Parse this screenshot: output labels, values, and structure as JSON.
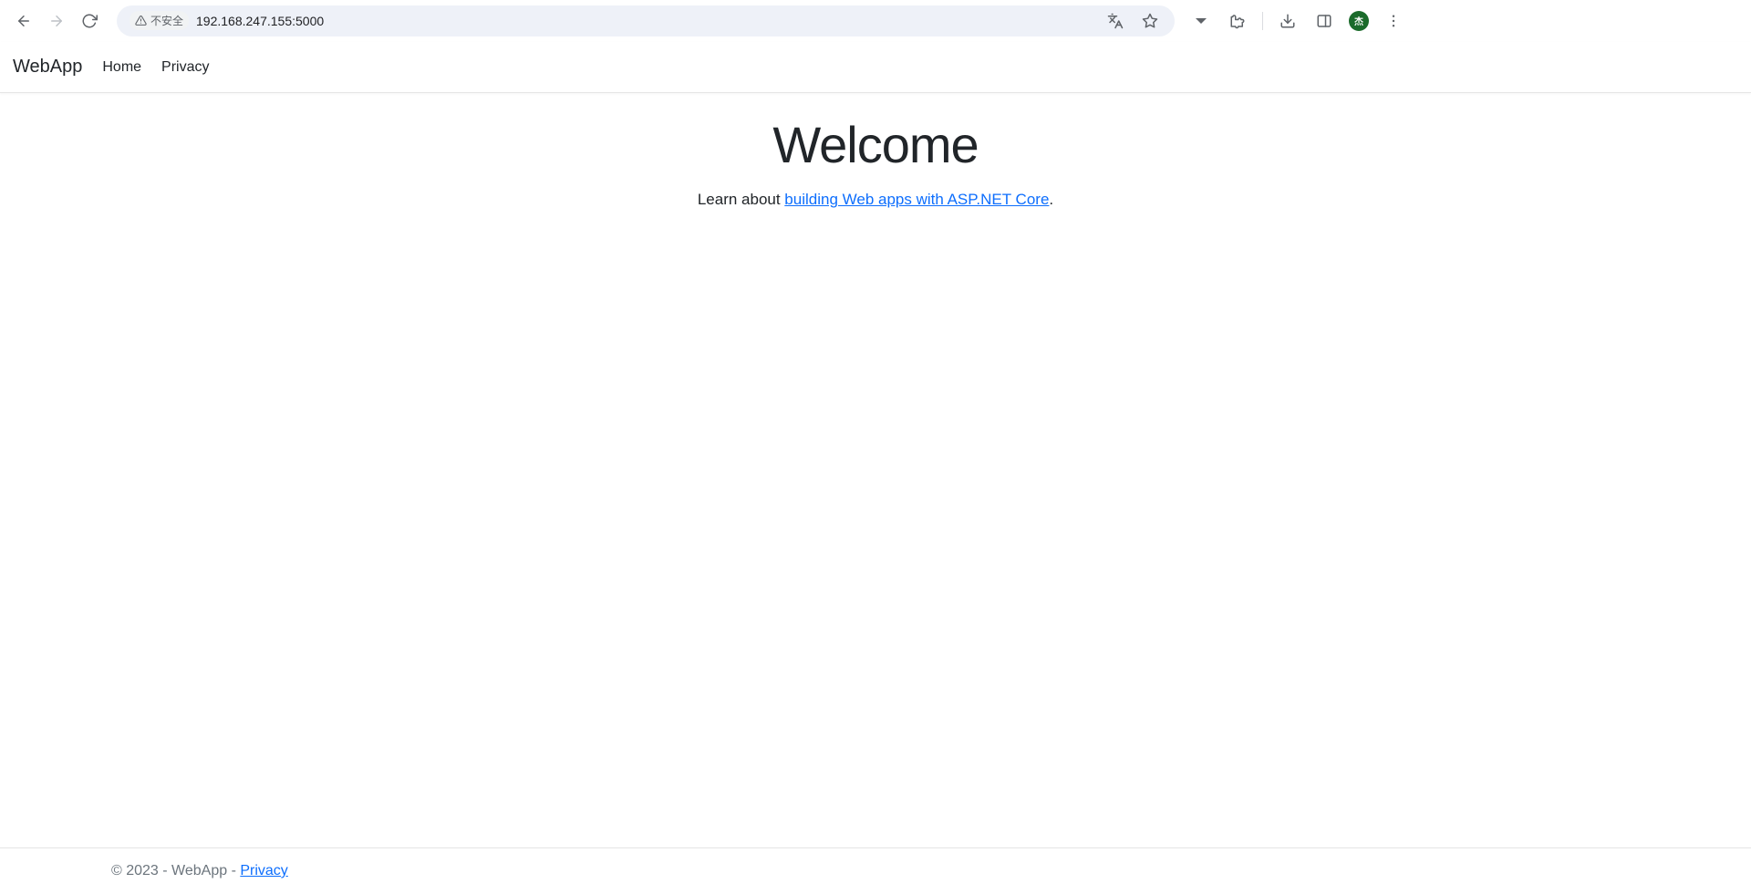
{
  "browser": {
    "insecure_label": "不安全",
    "url": "192.168.247.155:5000",
    "avatar_initial": "杰"
  },
  "navbar": {
    "brand": "WebApp",
    "links": {
      "home": "Home",
      "privacy": "Privacy"
    }
  },
  "main": {
    "title": "Welcome",
    "lead_prefix": "Learn about ",
    "lead_link": "building Web apps with ASP.NET Core",
    "lead_suffix": "."
  },
  "footer": {
    "copyright": "© 2023 - WebApp - ",
    "privacy_link": "Privacy"
  }
}
